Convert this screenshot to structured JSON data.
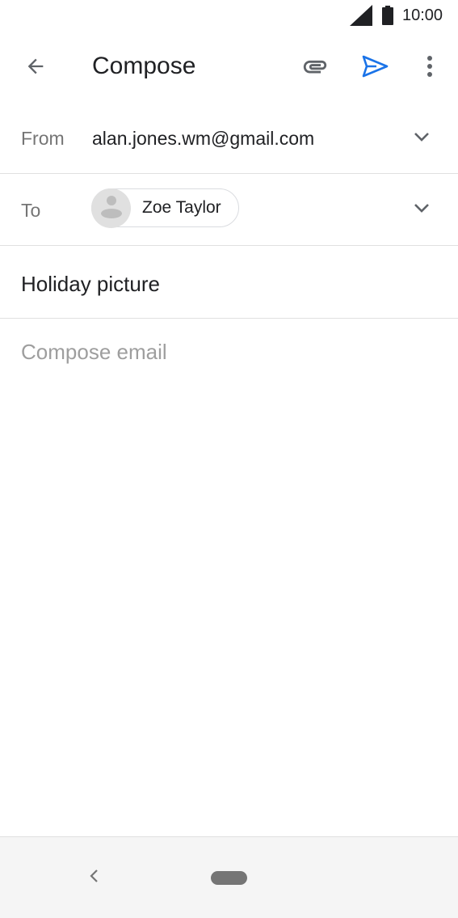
{
  "status_bar": {
    "time": "10:00",
    "signal_icon": "cell-signal-icon",
    "battery_icon": "battery-icon"
  },
  "app_bar": {
    "title": "Compose",
    "back_icon": "arrow-back-icon",
    "attach_icon": "paperclip-icon",
    "send_icon": "send-icon",
    "more_icon": "more-vert-icon",
    "accent_color": "#1a73e8"
  },
  "from": {
    "label": "From",
    "value": "alan.jones.wm@gmail.com"
  },
  "to": {
    "label": "To",
    "recipients": [
      {
        "name": "Zoe Taylor"
      }
    ]
  },
  "subject": {
    "value": "Holiday picture"
  },
  "body": {
    "placeholder": "Compose email",
    "value": ""
  },
  "nav_bar": {
    "back_icon": "nav-back-icon",
    "home_icon": "home-pill-icon"
  }
}
